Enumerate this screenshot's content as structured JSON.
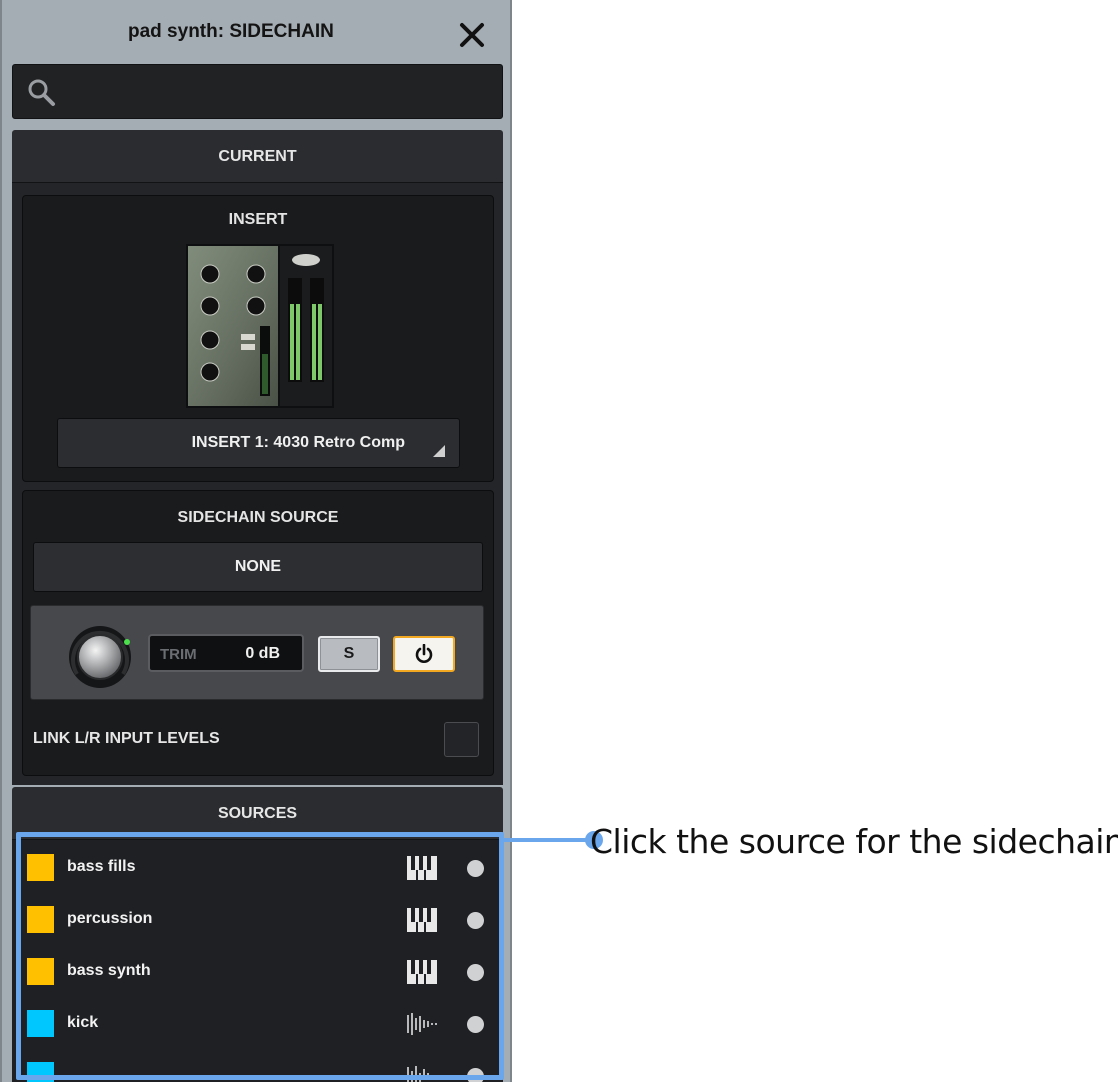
{
  "window": {
    "title": "pad synth: SIDECHAIN"
  },
  "search": {
    "placeholder": "",
    "value": ""
  },
  "current": {
    "header": "CURRENT",
    "insert": {
      "title": "INSERT",
      "selected": "INSERT 1: 4030 Retro Comp"
    },
    "sidechain": {
      "title": "SIDECHAIN SOURCE",
      "source": "NONE",
      "trim_label": "TRIM",
      "trim_value": "0 dB",
      "solo_label": "S",
      "power_on": true
    },
    "link_levels": {
      "label": "LINK L/R INPUT LEVELS",
      "checked": false
    }
  },
  "sources": {
    "header": "SOURCES",
    "items": [
      {
        "name": "bass fills",
        "color": "#ffc000",
        "type": "piano-icon"
      },
      {
        "name": "percussion",
        "color": "#ffc000",
        "type": "piano-icon"
      },
      {
        "name": "bass synth",
        "color": "#ffc000",
        "type": "piano-icon"
      },
      {
        "name": "kick",
        "color": "#00c8ff",
        "type": "waveform-icon"
      }
    ]
  },
  "callout": {
    "text": "Click the source for the sidechain"
  },
  "colors": {
    "highlight": "#6aa6ec",
    "accent": "#f2a820"
  }
}
